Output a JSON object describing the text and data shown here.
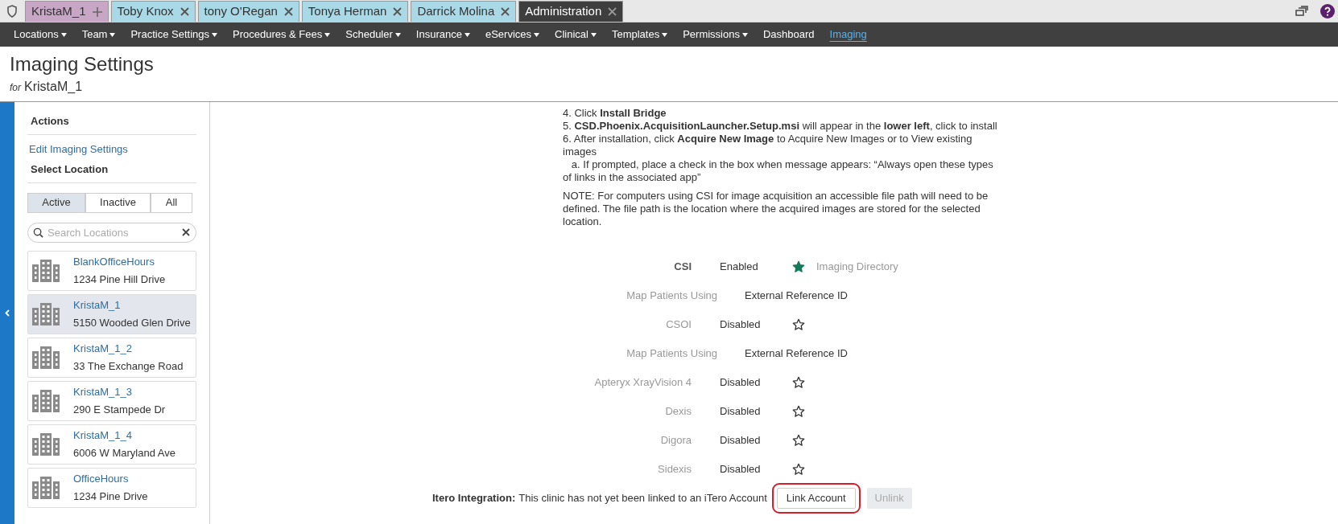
{
  "tabs": [
    {
      "label": "KristaM_1",
      "color": "#c8a6c6",
      "kind": "add",
      "selected": false
    },
    {
      "label": "Toby Knox",
      "color": "#a9d8e6",
      "kind": "close",
      "selected": false
    },
    {
      "label": "tony O'Regan",
      "color": "#a9d8e6",
      "kind": "close",
      "selected": false
    },
    {
      "label": "Tonya Herman",
      "color": "#a9d8e6",
      "kind": "close",
      "selected": false
    },
    {
      "label": "Darrick Molina",
      "color": "#a9d8e6",
      "kind": "close",
      "selected": false
    },
    {
      "label": "Administration",
      "color": "#3e3e3e",
      "kind": "close",
      "selected": true
    }
  ],
  "nav": [
    {
      "label": "Locations",
      "has_menu": true,
      "selected": false
    },
    {
      "label": "Team",
      "has_menu": true,
      "selected": false
    },
    {
      "label": "Practice Settings",
      "has_menu": true,
      "selected": false
    },
    {
      "label": "Procedures & Fees",
      "has_menu": true,
      "selected": false
    },
    {
      "label": "Scheduler",
      "has_menu": true,
      "selected": false
    },
    {
      "label": "Insurance",
      "has_menu": true,
      "selected": false
    },
    {
      "label": "eServices",
      "has_menu": true,
      "selected": false
    },
    {
      "label": "Clinical",
      "has_menu": true,
      "selected": false
    },
    {
      "label": "Templates",
      "has_menu": true,
      "selected": false
    },
    {
      "label": "Permissions",
      "has_menu": true,
      "selected": false
    },
    {
      "label": "Dashboard",
      "has_menu": false,
      "selected": false
    },
    {
      "label": "Imaging",
      "has_menu": false,
      "selected": true
    }
  ],
  "header": {
    "title": "Imaging Settings",
    "for_label": "for",
    "for_value": "KristaM_1"
  },
  "sidebar": {
    "actions_title": "Actions",
    "action_link": "Edit Imaging Settings",
    "locations_title": "Select Location",
    "filters": [
      {
        "label": "Active",
        "selected": true
      },
      {
        "label": "Inactive",
        "selected": false
      },
      {
        "label": "All",
        "selected": false
      }
    ],
    "search": {
      "placeholder": "Search Locations"
    },
    "locations": [
      {
        "name": "BlankOfficeHours",
        "address": "1234 Pine Hill Drive",
        "selected": false
      },
      {
        "name": "KristaM_1",
        "address": "5150 Wooded Glen Drive",
        "selected": true
      },
      {
        "name": "KristaM_1_2",
        "address": "33 The Exchange Road",
        "selected": false
      },
      {
        "name": "KristaM_1_3",
        "address": "290 E Stampede Dr",
        "selected": false
      },
      {
        "name": "KristaM_1_4",
        "address": "6006 W Maryland Ave",
        "selected": false
      },
      {
        "name": "OfficeHours",
        "address": "1234 Pine Drive",
        "selected": false
      }
    ]
  },
  "instructions": [
    "4. Click **Install Bridge**",
    "5. **CSD.Phoenix.AcquisitionLauncher.Setup.msi** will appear in the **lower left**, click to install",
    "6. After installation, click **Acquire New Image** to Acquire New Images or to View existing images",
    "   a. If prompted, place a check in the box when message appears: “Always open these types of links in the associated app”"
  ],
  "note": "NOTE: For computers using CSI for image acquisition an accessible file path will need to be defined. The file path is the location where the acquired images are stored for the selected location.",
  "settings": [
    {
      "kind": "integration",
      "name": "CSI",
      "status": "Enabled",
      "enabled": true,
      "starred": true,
      "extra": "Imaging Directory"
    },
    {
      "kind": "mapping",
      "label": "Map Patients Using",
      "value": "External Reference ID"
    },
    {
      "kind": "integration",
      "name": "CSOI",
      "status": "Disabled",
      "enabled": false,
      "starred": false
    },
    {
      "kind": "mapping",
      "label": "Map Patients Using",
      "value": "External Reference ID"
    },
    {
      "kind": "integration",
      "name": "Apteryx XrayVision 4",
      "status": "Disabled",
      "enabled": false,
      "starred": false
    },
    {
      "kind": "integration",
      "name": "Dexis",
      "status": "Disabled",
      "enabled": false,
      "starred": false
    },
    {
      "kind": "integration",
      "name": "Digora",
      "status": "Disabled",
      "enabled": false,
      "starred": false
    },
    {
      "kind": "integration",
      "name": "Sidexis",
      "status": "Disabled",
      "enabled": false,
      "starred": false
    }
  ],
  "itero": {
    "label": "Itero Integration:",
    "message": "This clinic has not yet been linked to an iTero Account",
    "link_button": "Link Account",
    "link_highlighted": true,
    "unlink_button": "Unlink",
    "unlink_disabled": true
  }
}
